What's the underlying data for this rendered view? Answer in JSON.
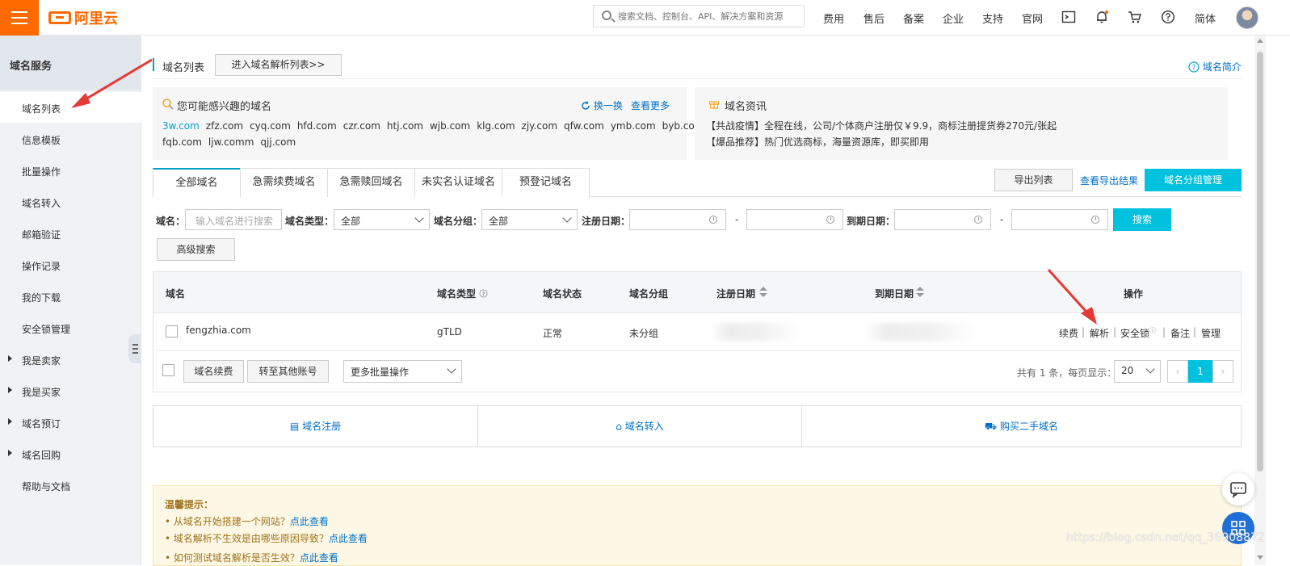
{
  "header": {
    "logo_text": "阿里云",
    "search_placeholder": "搜索文档、控制台、API、解决方案和资源",
    "nav": [
      "费用",
      "售后",
      "备案",
      "企业",
      "支持",
      "官网"
    ],
    "lang": "简体"
  },
  "sidebar": {
    "title": "域名服务",
    "items": [
      {
        "label": "域名列表"
      },
      {
        "label": "信息模板"
      },
      {
        "label": "批量操作"
      },
      {
        "label": "域名转入"
      },
      {
        "label": "邮箱验证"
      },
      {
        "label": "操作记录"
      },
      {
        "label": "我的下载"
      },
      {
        "label": "安全锁管理"
      },
      {
        "label": "我是卖家"
      },
      {
        "label": "我是买家"
      },
      {
        "label": "域名预订"
      },
      {
        "label": "域名回购"
      },
      {
        "label": "帮助与文档"
      }
    ]
  },
  "page": {
    "title": "域名列表",
    "goto_dns_button": "进入域名解析列表>>",
    "intro_link": "域名简介"
  },
  "interest_card": {
    "title": "您可能感兴趣的域名",
    "swap": "换一换",
    "more": "查看更多",
    "domains": [
      "3w.com",
      "zfz.com",
      "cyq.com",
      "hfd.com",
      "czr.com",
      "htj.com",
      "wjb.com",
      "klg.com",
      "zjy.com",
      "qfw.com",
      "ymb.com",
      "byb.com",
      "fqb.com",
      "ljw.comm",
      "qjj.com"
    ]
  },
  "news_card": {
    "title": "域名资讯",
    "lines": [
      "【共战疫情】全程在线，公司/个体商户注册仅￥9.9，商标注册提货券270元/张起",
      "【爆品推荐】热门优选商标，海量资源库，即买即用"
    ]
  },
  "tabs": [
    "全部域名",
    "急需续费域名",
    "急需赎回域名",
    "未实名认证域名",
    "预登记域名"
  ],
  "toolbar": {
    "export_list": "导出列表",
    "view_exports": "查看导出结果",
    "group_manage": "域名分组管理"
  },
  "filters": {
    "domain_label": "域名：",
    "domain_placeholder": "输入域名进行搜索",
    "type_label": "域名类型：",
    "type_value": "全部",
    "group_label": "域名分组：",
    "group_value": "全部",
    "reg_date_label": "注册日期：",
    "exp_date_label": "到期日期：",
    "dash": "-",
    "search_button": "搜索",
    "advanced_button": "高级搜索"
  },
  "table": {
    "headers": [
      "域名",
      "域名类型",
      "域名状态",
      "域名分组",
      "注册日期",
      "到期日期",
      "操作"
    ],
    "rows": [
      {
        "domain": "fengzhia.com",
        "type": "gTLD",
        "status": "正常",
        "group": "未分组",
        "actions": [
          "续费",
          "解析",
          "安全锁",
          "备注",
          "管理"
        ]
      }
    ],
    "sep": "|"
  },
  "footer": {
    "renew": "域名续费",
    "transfer_account": "转至其他账号",
    "batch": "更多批量操作",
    "total_text": "共有 1 条，每页显示：",
    "page_size": "20",
    "current_page": "1",
    "prev": "‹",
    "next": "›"
  },
  "quick_links": [
    "域名注册",
    "域名转入",
    "购买二手域名"
  ],
  "tips": {
    "title": "温馨提示：",
    "items": [
      {
        "text": "• 从域名开始搭建一个网站？",
        "link": "点此查看"
      },
      {
        "text": "• 域名解析不生效是由哪些原因导致？",
        "link": "点此查看"
      },
      {
        "text": "• 如何测试域名解析是否生效？",
        "link": "点此查看"
      }
    ]
  },
  "watermark": "https://blog.csdn.net/qq_36908872",
  "colors": {
    "brand": "#ff6a00",
    "accent": "#00c1de",
    "link": "#0070cc",
    "annotation": "#e53935"
  }
}
